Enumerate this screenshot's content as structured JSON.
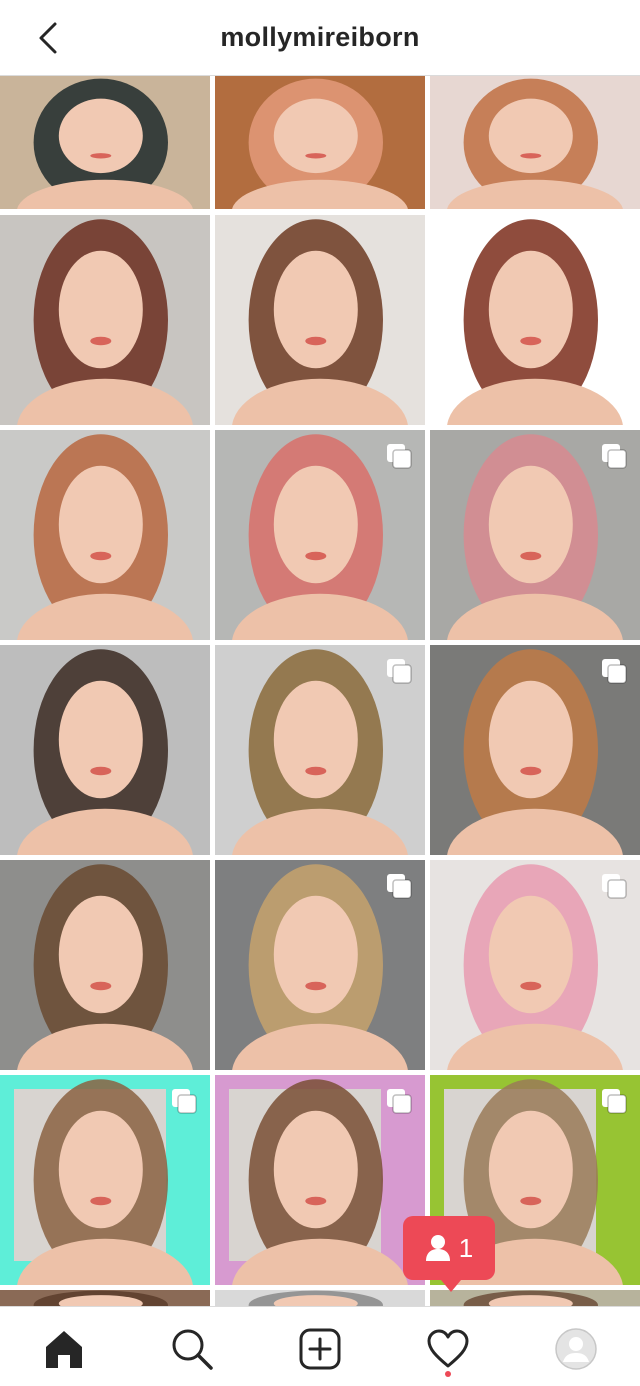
{
  "header": {
    "title": "mollymireiborn",
    "back_icon": "chevron-left-icon"
  },
  "grid": {
    "tiles": [
      {
        "row": 0,
        "col": 0,
        "multi": false,
        "style": "portrait",
        "bg": "#c9b49a",
        "accent": "#1f2a2c"
      },
      {
        "row": 0,
        "col": 1,
        "multi": false,
        "style": "portrait",
        "bg": "#b26d3f",
        "accent": "#e39a7a"
      },
      {
        "row": 0,
        "col": 2,
        "multi": false,
        "style": "portrait",
        "bg": "#e7d7d2",
        "accent": "#c07043"
      },
      {
        "row": 1,
        "col": 0,
        "multi": false,
        "style": "portrait",
        "bg": "#c8c5c1",
        "accent": "#6b2d1e"
      },
      {
        "row": 1,
        "col": 1,
        "multi": false,
        "style": "portrait",
        "bg": "#e5e1dd",
        "accent": "#6d3a22"
      },
      {
        "row": 1,
        "col": 2,
        "multi": false,
        "style": "portrait",
        "bg": "#ffffff",
        "accent": "#7b2d1b"
      },
      {
        "row": 2,
        "col": 0,
        "multi": false,
        "style": "portrait",
        "bg": "#c9c9c7",
        "accent": "#b9673f"
      },
      {
        "row": 2,
        "col": 1,
        "multi": true,
        "style": "portrait",
        "bg": "#b6b7b5",
        "accent": "#d9706a"
      },
      {
        "row": 2,
        "col": 2,
        "multi": true,
        "style": "portrait",
        "bg": "#a8a8a5",
        "accent": "#d88a8f"
      },
      {
        "row": 3,
        "col": 0,
        "multi": false,
        "style": "portrait",
        "bg": "#bdbdbd",
        "accent": "#3b2a22"
      },
      {
        "row": 3,
        "col": 1,
        "multi": true,
        "style": "portrait",
        "bg": "#cfcfcf",
        "accent": "#8a6a3a"
      },
      {
        "row": 3,
        "col": 2,
        "multi": true,
        "style": "portrait",
        "bg": "#7a7a78",
        "accent": "#c07a45"
      },
      {
        "row": 4,
        "col": 0,
        "multi": false,
        "style": "portrait",
        "bg": "#8e8e8c",
        "accent": "#6a4a30"
      },
      {
        "row": 4,
        "col": 1,
        "multi": true,
        "style": "portrait",
        "bg": "#7e7f80",
        "accent": "#c6a26c"
      },
      {
        "row": 4,
        "col": 2,
        "multi": true,
        "style": "portrait",
        "bg": "#e7e3e1",
        "accent": "#e79bb0"
      },
      {
        "row": 5,
        "col": 0,
        "multi": true,
        "style": "framed",
        "bg": "#5eeed8",
        "accent": "#8b6242"
      },
      {
        "row": 5,
        "col": 1,
        "multi": true,
        "style": "framed",
        "bg": "#d79ad0",
        "accent": "#7a4f35"
      },
      {
        "row": 5,
        "col": 2,
        "multi": true,
        "style": "framed",
        "bg": "#97c433",
        "accent": "#9a7a58"
      },
      {
        "row": 6,
        "col": 0,
        "multi": false,
        "style": "partial",
        "bg": "#8a6a56",
        "accent": "#5a3c2a"
      },
      {
        "row": 6,
        "col": 1,
        "multi": false,
        "style": "partial",
        "bg": "#d9d9d9",
        "accent": "#888888"
      },
      {
        "row": 6,
        "col": 2,
        "multi": false,
        "style": "partial",
        "bg": "#b7b39c",
        "accent": "#6d4d3a"
      }
    ]
  },
  "notification": {
    "icon": "person-icon",
    "count": "1"
  },
  "nav": {
    "items": [
      {
        "name": "home-icon"
      },
      {
        "name": "search-icon"
      },
      {
        "name": "new-post-icon"
      },
      {
        "name": "activity-heart-icon"
      },
      {
        "name": "profile-avatar-icon"
      }
    ]
  },
  "colors": {
    "text": "#262626",
    "border": "#dbdbdb",
    "notification": "#ed4956"
  }
}
